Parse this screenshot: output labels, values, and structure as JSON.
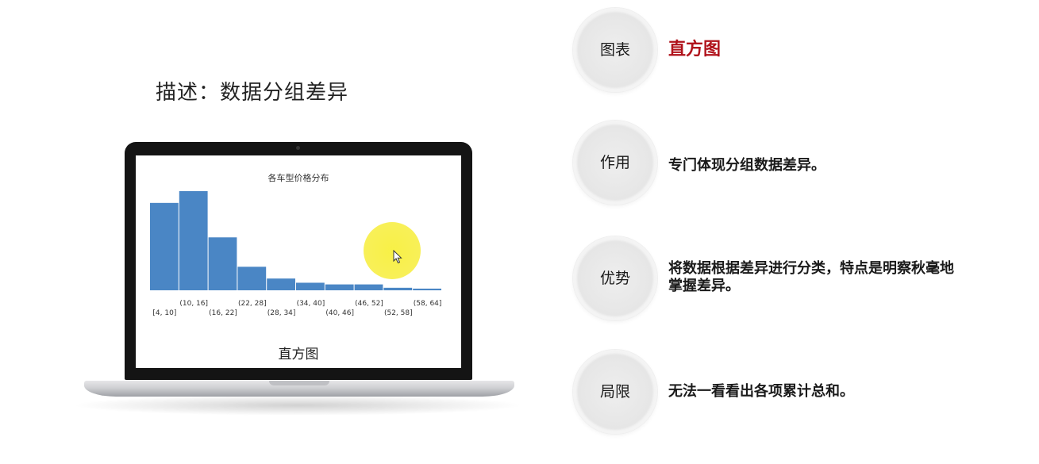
{
  "description": "描述：数据分组差异",
  "laptop": {
    "caption": "直方图"
  },
  "chart_data": {
    "type": "bar",
    "title": "各车型价格分布",
    "categories": [
      "[4, 10]",
      "(10, 16]",
      "(16, 22]",
      "(22, 28]",
      "(28, 34]",
      "(34, 40]",
      "(40, 46]",
      "(46, 52]",
      "(52, 58]",
      "(58, 64]"
    ],
    "values": [
      104,
      118,
      63,
      28,
      14,
      9,
      7,
      7,
      3,
      2
    ],
    "xlabel": "",
    "ylabel": "",
    "grid": false,
    "color": "#4a86c5"
  },
  "rows": [
    {
      "label": "图表",
      "text": "直方图",
      "text_color": "#b0121b"
    },
    {
      "label": "作用",
      "text": "专门体现分组数据差异。"
    },
    {
      "label": "优势",
      "text_line1": "将数据根据差异进行分类，特点是明察秋毫地",
      "text_line2": "掌握差异。"
    },
    {
      "label": "局限",
      "text": "无法一看看出各项累计总和。"
    }
  ],
  "highlight_color": "#f7ef3c"
}
